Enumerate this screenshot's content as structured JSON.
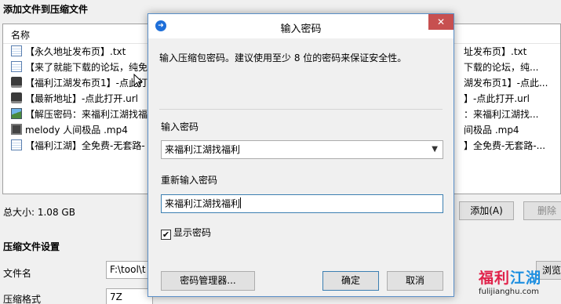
{
  "background": {
    "section_title": "添加文件到压缩文件",
    "column_name": "名称",
    "files": [
      {
        "icon": "text-file-icon",
        "name": "【永久地址发布页】.txt"
      },
      {
        "icon": "text-file-icon",
        "name": "【来了就能下载的论坛，纯免费"
      },
      {
        "icon": "url-file-icon",
        "name": "【福利江湖发布页1】-点此打开"
      },
      {
        "icon": "url-file-icon",
        "name": "【最新地址】-点此打开.url"
      },
      {
        "icon": "image-file-icon",
        "name": "【解压密码：来福利江湖找福利"
      },
      {
        "icon": "video-file-icon",
        "name": "melody 人间极品 .mp4"
      },
      {
        "icon": "text-file-icon",
        "name": "【福利江湖】全免费-无套路-"
      }
    ],
    "files_right": [
      "址发布页】.txt",
      "下载的论坛，纯...",
      "湖发布页1】-点此...",
      "】-点此打开.url",
      "：来福利江湖找...",
      "间极品 .mp4",
      "】全免费-无套路-..."
    ],
    "total_size": "总大小: 1.08 GB",
    "add_button": "添加(A)",
    "delete_button": "删除",
    "settings_title": "压缩文件设置",
    "filename_label": "文件名",
    "filename_value": "F:\\tool\\t",
    "format_label": "压缩格式",
    "format_value": "7Z",
    "browse_button": "浏览",
    "watermark_main_a": "福利",
    "watermark_main_b": "江湖",
    "watermark_url": "fulijianghu.com"
  },
  "dialog": {
    "title": "输入密码",
    "close_glyph": "✕",
    "description": "输入压缩包密码。建议使用至少 8 位的密码来保证安全性。",
    "password_label": "输入密码",
    "password_value": "来福利江湖找福利",
    "repeat_label": "重新输入密码",
    "repeat_value": "来福利江湖找福利",
    "show_password_label": "显示密码",
    "show_password_checked": true,
    "manager_button": "密码管理器...",
    "ok_button": "确定",
    "cancel_button": "取消"
  }
}
